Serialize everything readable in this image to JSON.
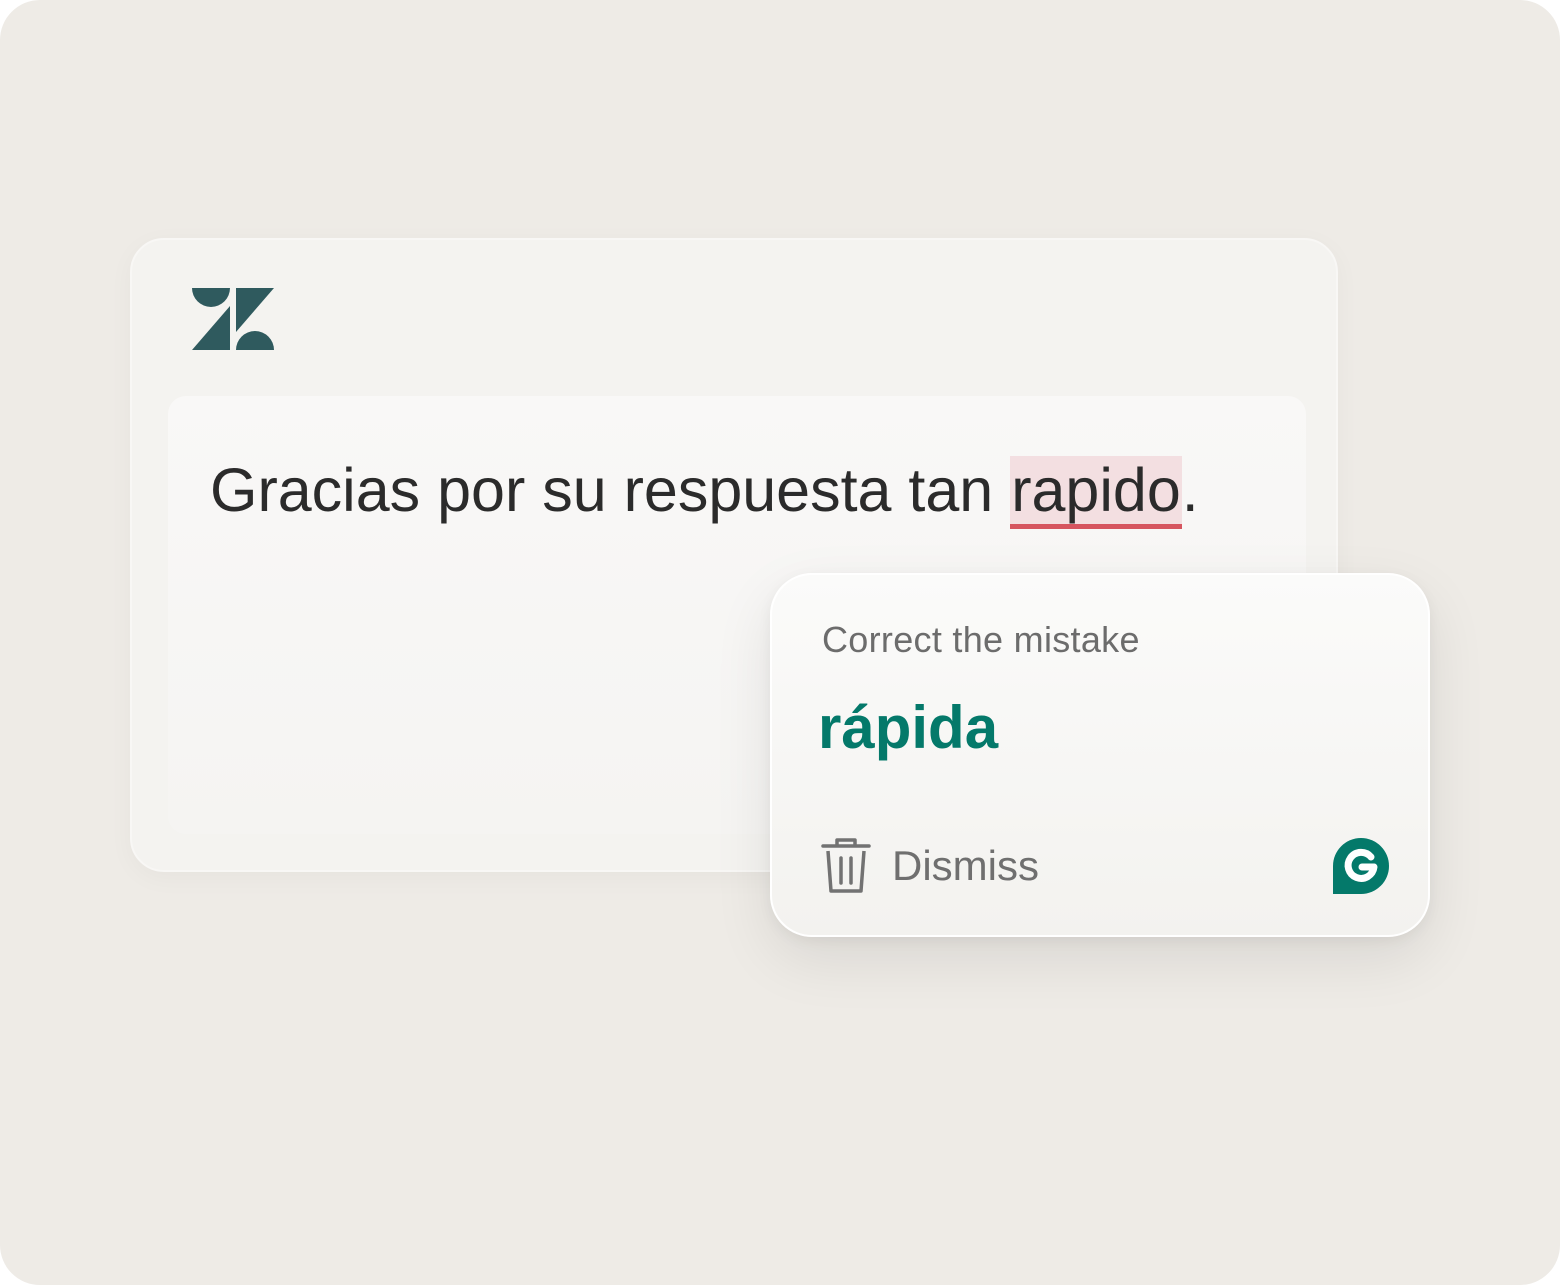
{
  "editor": {
    "logo": "zendesk-logo-icon",
    "message_before": "Gracias por su respuesta tan ",
    "flagged_word": "rapido",
    "message_after": "."
  },
  "suggestion_card": {
    "heading": "Correct the mistake",
    "suggestion": "rápida",
    "dismiss_label": "Dismiss",
    "dismiss_icon": "trash-icon",
    "brand_icon": "grammarly-icon"
  },
  "colors": {
    "background": "#eeebe6",
    "zendesk_brand": "#2f5a5e",
    "suggestion_green": "#04796a",
    "error_underline": "#d6555f",
    "error_highlight": "#f3dfe1"
  }
}
